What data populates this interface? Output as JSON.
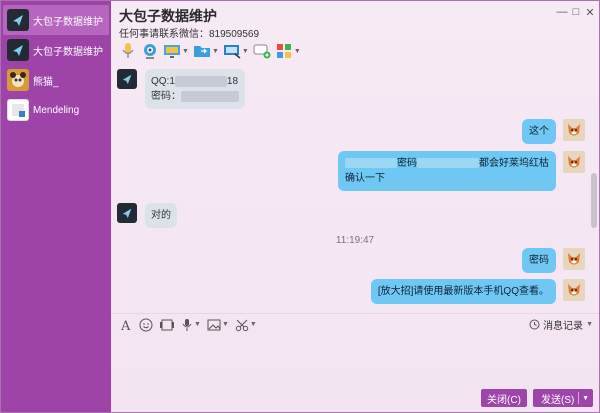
{
  "window": {
    "title": "大包子数据维护",
    "subtitle": "任何事请联系微信：819509569",
    "minimize": "—",
    "maximize": "□",
    "close": "✕"
  },
  "sidebar": {
    "items": [
      {
        "name": "大包子数据维护",
        "avatar": "dark-logo"
      },
      {
        "name": "大包子数据维护",
        "avatar": "dark-logo"
      },
      {
        "name": "熊猫_",
        "avatar": "panda"
      },
      {
        "name": "Mendeling",
        "avatar": "generic"
      }
    ]
  },
  "toolbar": {
    "icons": [
      "microphone-icon",
      "webcam-icon",
      "screen-share-icon",
      "folder-transfer-icon",
      "remote-desktop-icon",
      "add-chat-icon",
      "apps-icon"
    ]
  },
  "messages": [
    {
      "side": "left",
      "line1_prefix": "QQ:1",
      "line1_suffix": "18",
      "line2_prefix": "密码："
    },
    {
      "side": "right",
      "text": "这个"
    },
    {
      "side": "right",
      "line1_middle": "密码",
      "line1_suffix": "都会好莱坞红枯",
      "line2": "确认一下"
    },
    {
      "side": "left",
      "text": "对的"
    },
    {
      "side": "right",
      "text": "密码"
    },
    {
      "side": "right",
      "text": "[放大招]请使用最新版本手机QQ查看。"
    }
  ],
  "timestamp": "11:19:47",
  "input_toolbar": {
    "history_label": "消息记录"
  },
  "buttons": {
    "close": "关闭(C)",
    "send": "发送(S)"
  },
  "colors": {
    "sidebar": "#9e44a8",
    "bubble_right": "#6ec8f3",
    "bubble_left": "#dce2ea",
    "button": "#9d45a9"
  }
}
